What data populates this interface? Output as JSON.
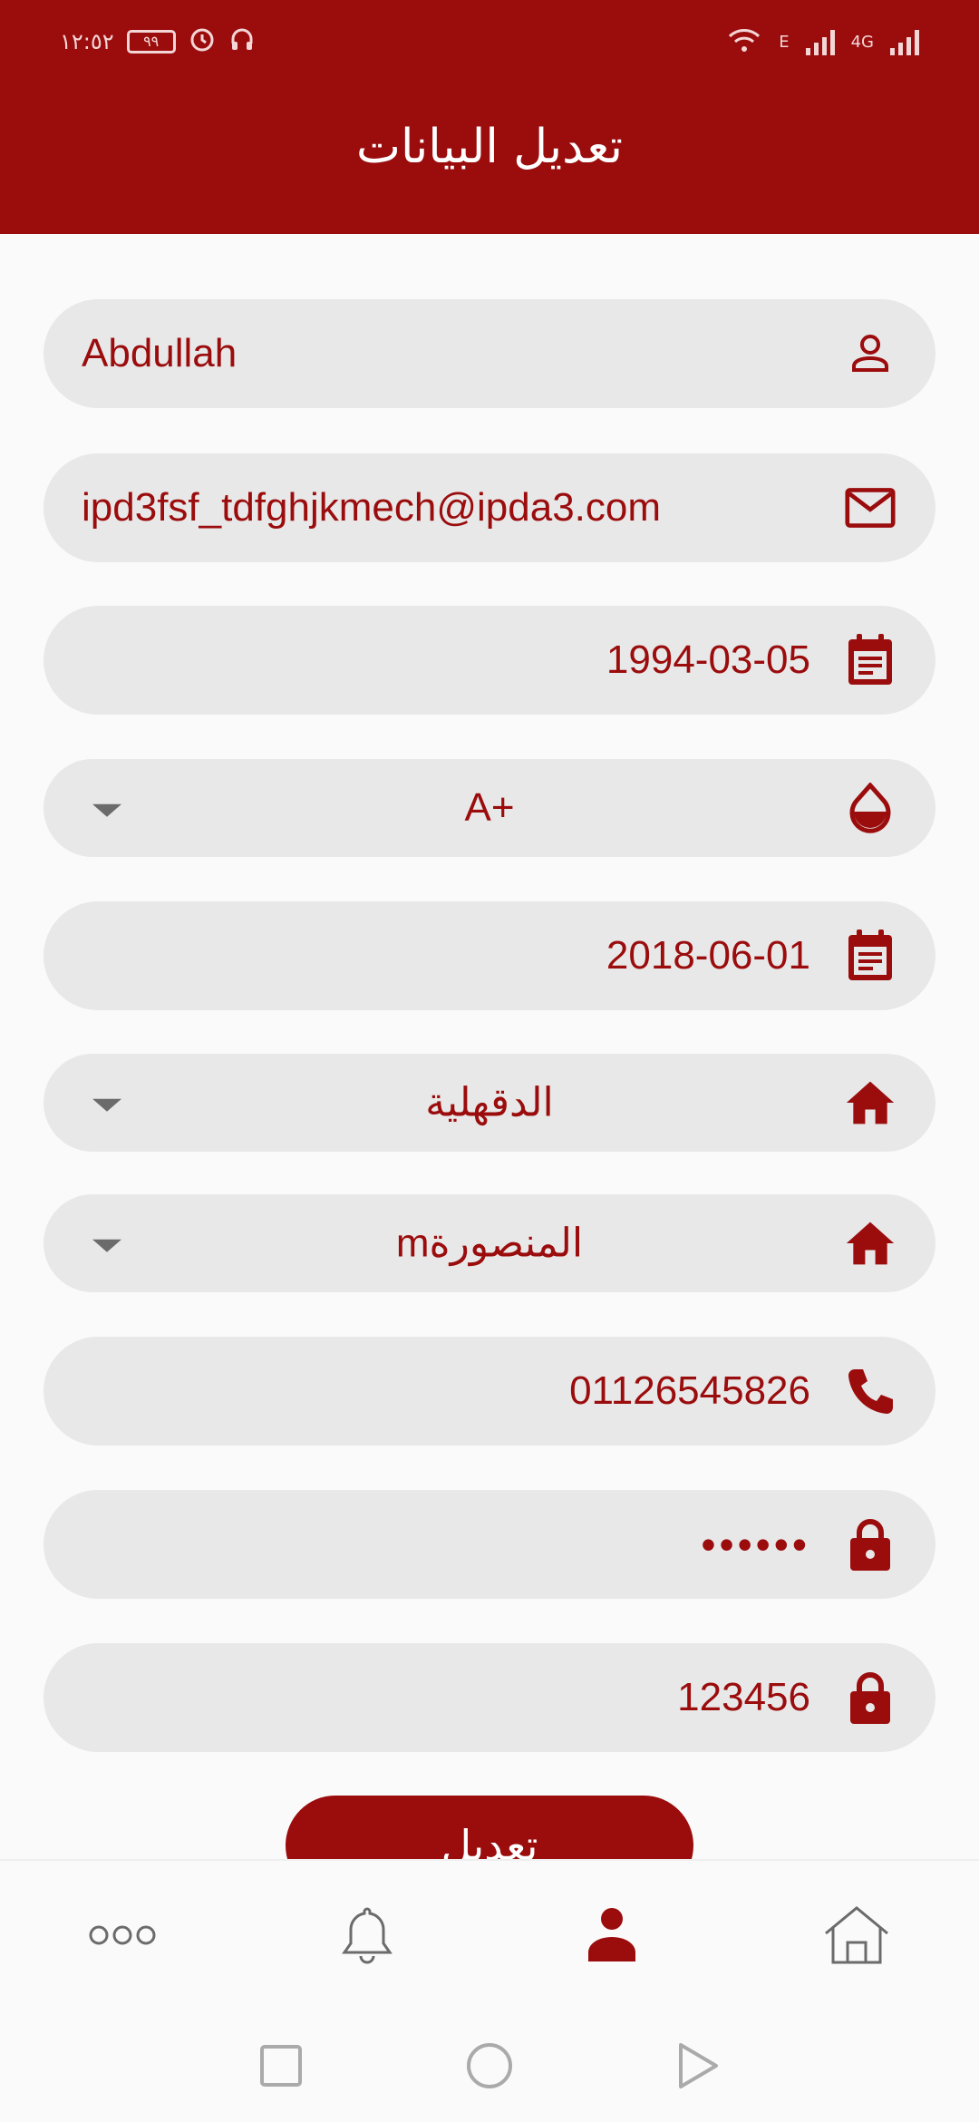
{
  "status_bar": {
    "time": "١٢:٥٢",
    "battery": "٩٩",
    "network_e": "E",
    "network_4g": "4G"
  },
  "header": {
    "title": "تعديل البيانات"
  },
  "form": {
    "name": "Abdullah",
    "email": "ipd3fsf_tdfghjkmech@ipda3.com",
    "birth_date": "1994-03-05",
    "blood_type": "A+",
    "last_donation_date": "2018-06-01",
    "governorate": "الدقهلية",
    "city": "mالمنصورة",
    "phone": "01126545826",
    "password": "••••••",
    "password_confirm": "123456"
  },
  "submit_label": "تعديل",
  "colors": {
    "primary": "#9b0c0d",
    "field_bg": "#e8e8e8",
    "page_bg": "#fafafa"
  },
  "icons": {
    "name": "person-icon",
    "email": "mail-icon",
    "dates": "calendar-icon",
    "blood": "drop-icon",
    "location": "home-icon",
    "phone": "phone-icon",
    "password": "lock-icon"
  },
  "bottom_nav": [
    "more-icon",
    "bell-icon",
    "profile-icon",
    "home-icon"
  ]
}
